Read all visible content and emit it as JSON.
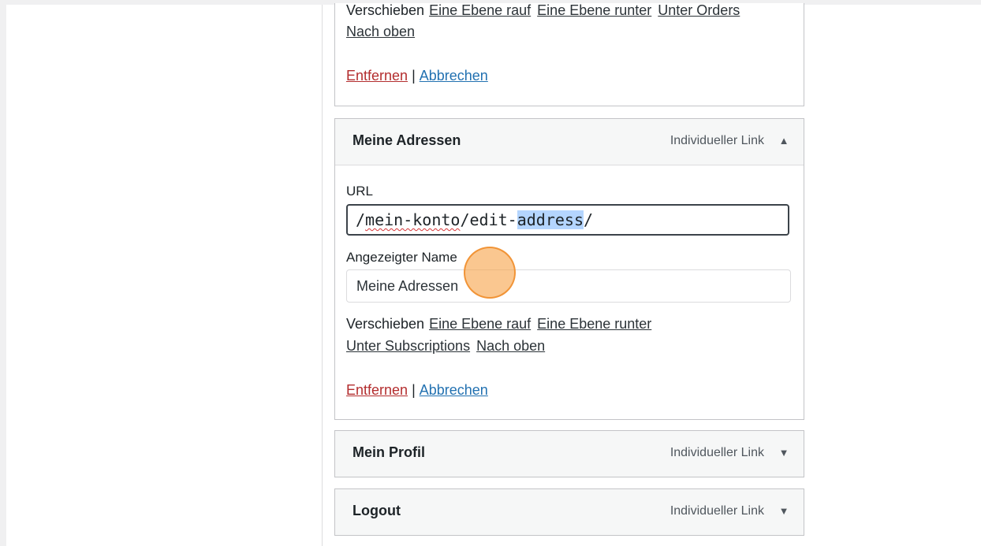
{
  "previous_item": {
    "move_label": "Verschieben",
    "move_links": [
      "Eine Ebene rauf",
      "Eine Ebene runter",
      "Unter Orders",
      "Nach oben"
    ],
    "remove_label": "Entfernen",
    "separator": "|",
    "cancel_label": "Abbrechen"
  },
  "menu_items": [
    {
      "title": "Meine Adressen",
      "type": "Individueller Link",
      "toggle": "▲",
      "expanded": true,
      "url_label": "URL",
      "url_value": {
        "slash1": "/",
        "squiggled": "mein-konto",
        "mid": "/edit-",
        "selected": "address",
        "tail": "/"
      },
      "name_label": "Angezeigter Name",
      "name_value": "Meine Adressen",
      "move_label": "Verschieben",
      "move_links": [
        "Eine Ebene rauf",
        "Eine Ebene runter",
        "Unter Subscriptions",
        "Nach oben"
      ],
      "remove_label": "Entfernen",
      "separator": "|",
      "cancel_label": "Abbrechen"
    },
    {
      "title": "Mein Profil",
      "type": "Individueller Link",
      "toggle": "▼",
      "expanded": false
    },
    {
      "title": "Logout",
      "type": "Individueller Link",
      "toggle": "▼",
      "expanded": false
    }
  ]
}
